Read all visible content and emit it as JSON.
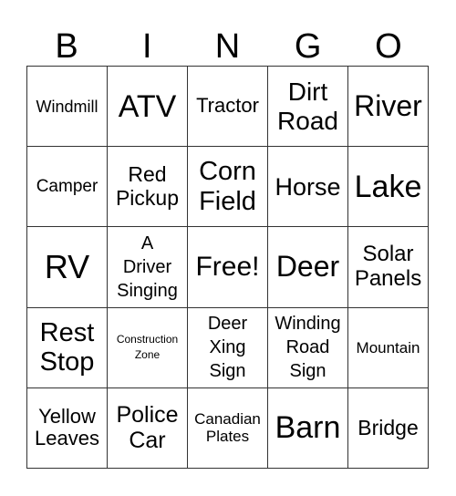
{
  "header": {
    "letters": [
      "B",
      "I",
      "N",
      "G",
      "O"
    ]
  },
  "card": {
    "rows": [
      [
        "Windmill",
        "ATV",
        "Tractor",
        "Dirt Road",
        "River"
      ],
      [
        "Camper",
        "Red Pickup",
        "Corn Field",
        "Horse",
        "Lake"
      ],
      [
        "RV",
        "A Driver Singing",
        "Free!",
        "Deer",
        "Solar Panels"
      ],
      [
        "Rest Stop",
        "Construction Zone",
        "Deer Xing Sign",
        "Winding Road Sign",
        "Mountain"
      ],
      [
        "Yellow Leaves",
        "Police Car",
        "Canadian Plates",
        "Barn",
        "Bridge"
      ]
    ],
    "free_space": "Free!"
  }
}
